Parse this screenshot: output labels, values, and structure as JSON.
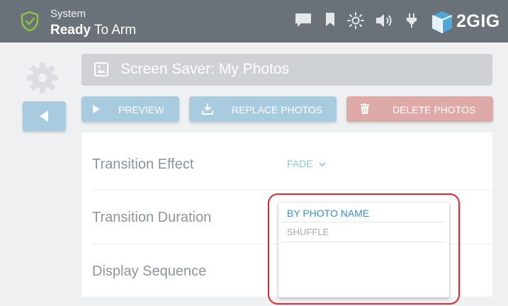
{
  "status": {
    "line1": "System",
    "line2_bold": "Ready",
    "line2_rest": " To Arm"
  },
  "header_icons": [
    "chat-icon",
    "bookmark-icon",
    "brightness-icon",
    "volume-icon",
    "power-plug-icon"
  ],
  "brand": {
    "name": "2GIG"
  },
  "page": {
    "title": "Screen Saver: My Photos",
    "title_icon": "image-icon"
  },
  "actions": {
    "preview": "PREVIEW",
    "replace": "REPLACE PHOTOS",
    "delete": "DELETE PHOTOS"
  },
  "settings": {
    "transition_effect_label": "Transition Effect",
    "transition_effect_value": "FADE",
    "transition_duration_label": "Transition Duration",
    "display_sequence_label": "Display Sequence"
  },
  "dropdown": {
    "options": [
      "BY PHOTO NAME",
      "SHUFFLE"
    ],
    "selected": "BY PHOTO NAME"
  },
  "colors": {
    "header": "#6b7178",
    "accent_blue": "#a9cbdf",
    "delete_red": "#deaaa7",
    "highlight": "#e1262d",
    "shield_green": "#8ec63f"
  }
}
